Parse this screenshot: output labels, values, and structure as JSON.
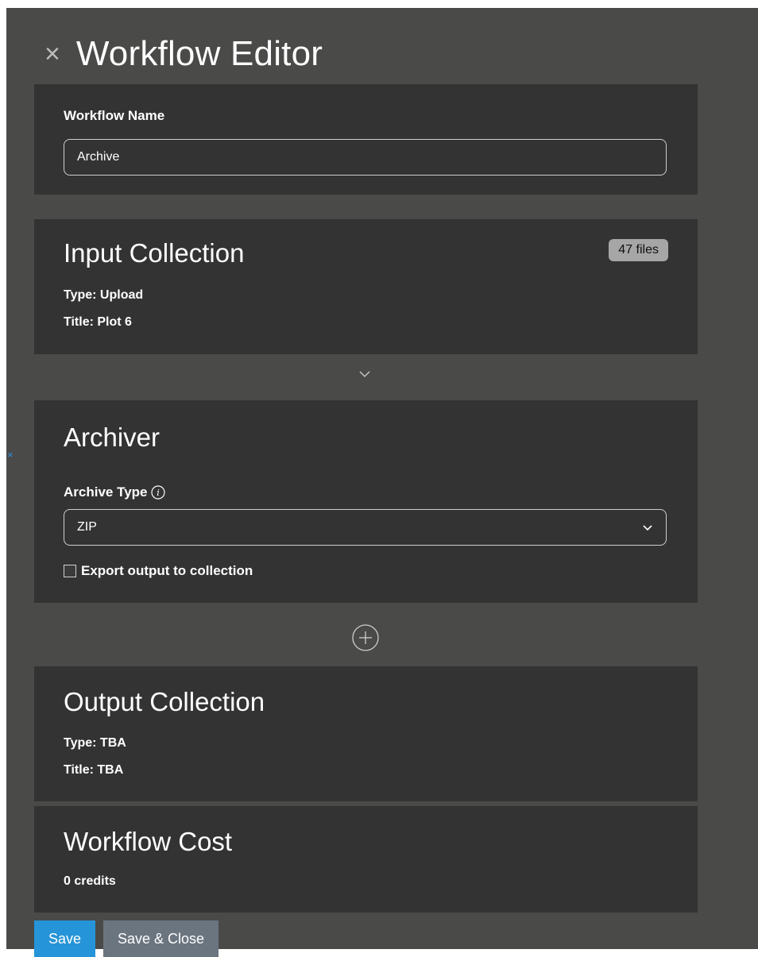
{
  "header": {
    "title": "Workflow Editor",
    "close_icon": "×"
  },
  "workflow_name": {
    "label": "Workflow Name",
    "value": "Archive"
  },
  "input_collection": {
    "title": "Input Collection",
    "badge": "47 files",
    "type_line": "Type: Upload",
    "title_line": "Title: Plot 6"
  },
  "archiver": {
    "title": "Archiver",
    "archive_type_label": "Archive Type",
    "archive_type_value": "ZIP",
    "export_label": "Export output to collection",
    "export_checked": false
  },
  "output_collection": {
    "title": "Output Collection",
    "type_line": "Type: TBA",
    "title_line": "Title: TBA"
  },
  "workflow_cost": {
    "title": "Workflow Cost",
    "value": "0 credits"
  },
  "footer": {
    "save_label": "Save",
    "save_close_label": "Save & Close"
  },
  "colors": {
    "page_bg": "#4a4a49",
    "card_bg": "#333333",
    "save_button": "#2694d8",
    "save_close_button": "#6b7580",
    "badge_bg": "#a6a6a6"
  }
}
